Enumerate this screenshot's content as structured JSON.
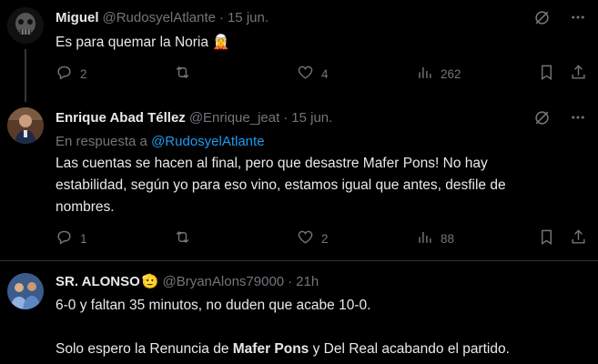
{
  "tweets": [
    {
      "name": "Miguel",
      "handle": "@RudosyelAtlante",
      "dot": "·",
      "time": "15 jun.",
      "text": "Es para quemar la Noria 🧝",
      "replies": "2",
      "retweets": "",
      "likes": "4",
      "views": "262"
    },
    {
      "name": "Enrique Abad Téllez",
      "handle": "@Enrique_jeat",
      "dot": "·",
      "time": "15 jun.",
      "reply_prefix": "En respuesta a ",
      "reply_to": "@RudosyelAtlante",
      "text_lines": [
        "Las cuentas se hacen al final, pero que desastre Mafer Pons! No hay",
        "estabilidad, según yo para eso vino, estamos igual que antes, desfile de",
        "nombres."
      ],
      "replies": "1",
      "retweets": "",
      "likes": "2",
      "views": "88"
    },
    {
      "name": "SR. ALONSO",
      "name_emoji": "🫡",
      "handle": "@BryanAlons79000",
      "dot": "·",
      "time": "21h",
      "text_line1": "6-0 y faltan 35 minutos, no duden que acabe 10-0.",
      "text_line2_a": "Solo espero la Renuncia de ",
      "text_line2_b": "Mafer Pons",
      "text_line2_c": " y Del Real acabando el partido."
    }
  ],
  "colors": {
    "background": "#000000",
    "text": "#e7e9ea",
    "muted": "#71767b",
    "link": "#1d9bf0",
    "divider": "#2f3336"
  },
  "icons": [
    "grok-icon",
    "more-icon",
    "reply-icon",
    "retweet-icon",
    "like-icon",
    "views-icon",
    "bookmark-icon",
    "share-icon"
  ]
}
